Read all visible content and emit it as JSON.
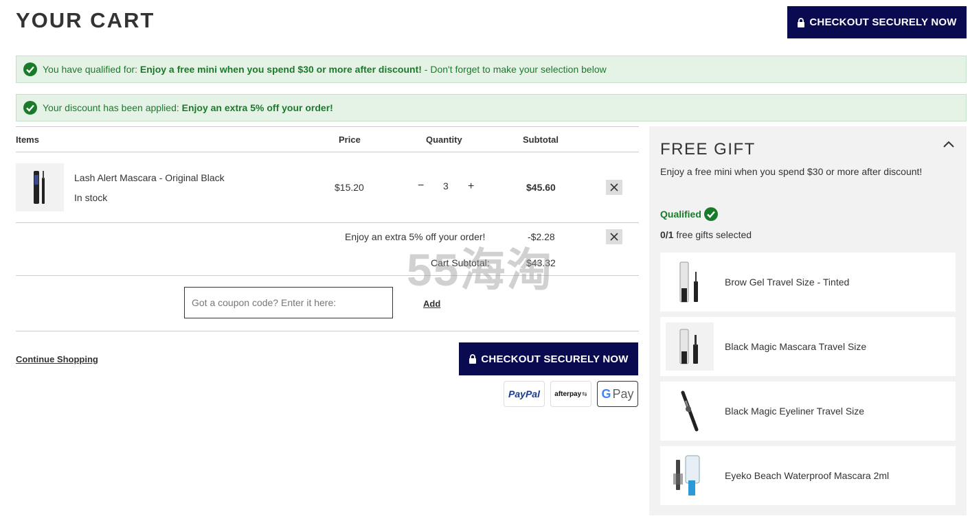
{
  "header": {
    "title": "YOUR CART",
    "checkout_label": "CHECKOUT SECURELY NOW"
  },
  "alerts": [
    {
      "prefix": "You have qualified for: ",
      "bold": "Enjoy a free mini when you spend $30 or more after discount!",
      "suffix": " - Don't forget to make your selection below"
    },
    {
      "prefix": "Your discount has been applied: ",
      "bold": "Enjoy an extra 5% off your order!",
      "suffix": ""
    }
  ],
  "table": {
    "headers": {
      "items": "Items",
      "price": "Price",
      "quantity": "Quantity",
      "subtotal": "Subtotal"
    }
  },
  "cart_item": {
    "name": "Lash Alert Mascara - Original Black",
    "stock": "In stock",
    "price": "$15.20",
    "quantity": "3",
    "minus": "−",
    "plus": "+",
    "subtotal": "$45.60"
  },
  "discount": {
    "label": "Enjoy an extra 5% off your order!",
    "amount": "-$2.28"
  },
  "cart_subtotal": {
    "label": "Cart Subtotal:",
    "value": "$43.32"
  },
  "coupon": {
    "placeholder": "Got a coupon code? Enter it here:",
    "add_label": "Add"
  },
  "footer": {
    "continue_label": "Continue Shopping",
    "checkout_label": "CHECKOUT SECURELY NOW",
    "payments": {
      "paypal": "PayPal",
      "afterpay": "afterpay",
      "gpay": "Pay"
    }
  },
  "free_gift": {
    "title": "FREE GIFT",
    "description": "Enjoy a free mini when you spend $30 or more after discount!",
    "status": "Qualified",
    "selected_count": "0",
    "selected_total": "/1",
    "selected_text": " free gifts selected",
    "items": [
      {
        "name": "Brow Gel Travel Size - Tinted"
      },
      {
        "name": "Black Magic Mascara Travel Size"
      },
      {
        "name": "Black Magic Eyeliner Travel Size"
      },
      {
        "name": "Eyeko Beach Waterproof Mascara 2ml"
      }
    ]
  },
  "watermark": "55海淘",
  "colors": {
    "primary": "#0a0a50",
    "success": "#1b7a2a",
    "alert_bg": "#e5f3e6",
    "panel_bg": "#f2f2f2"
  }
}
